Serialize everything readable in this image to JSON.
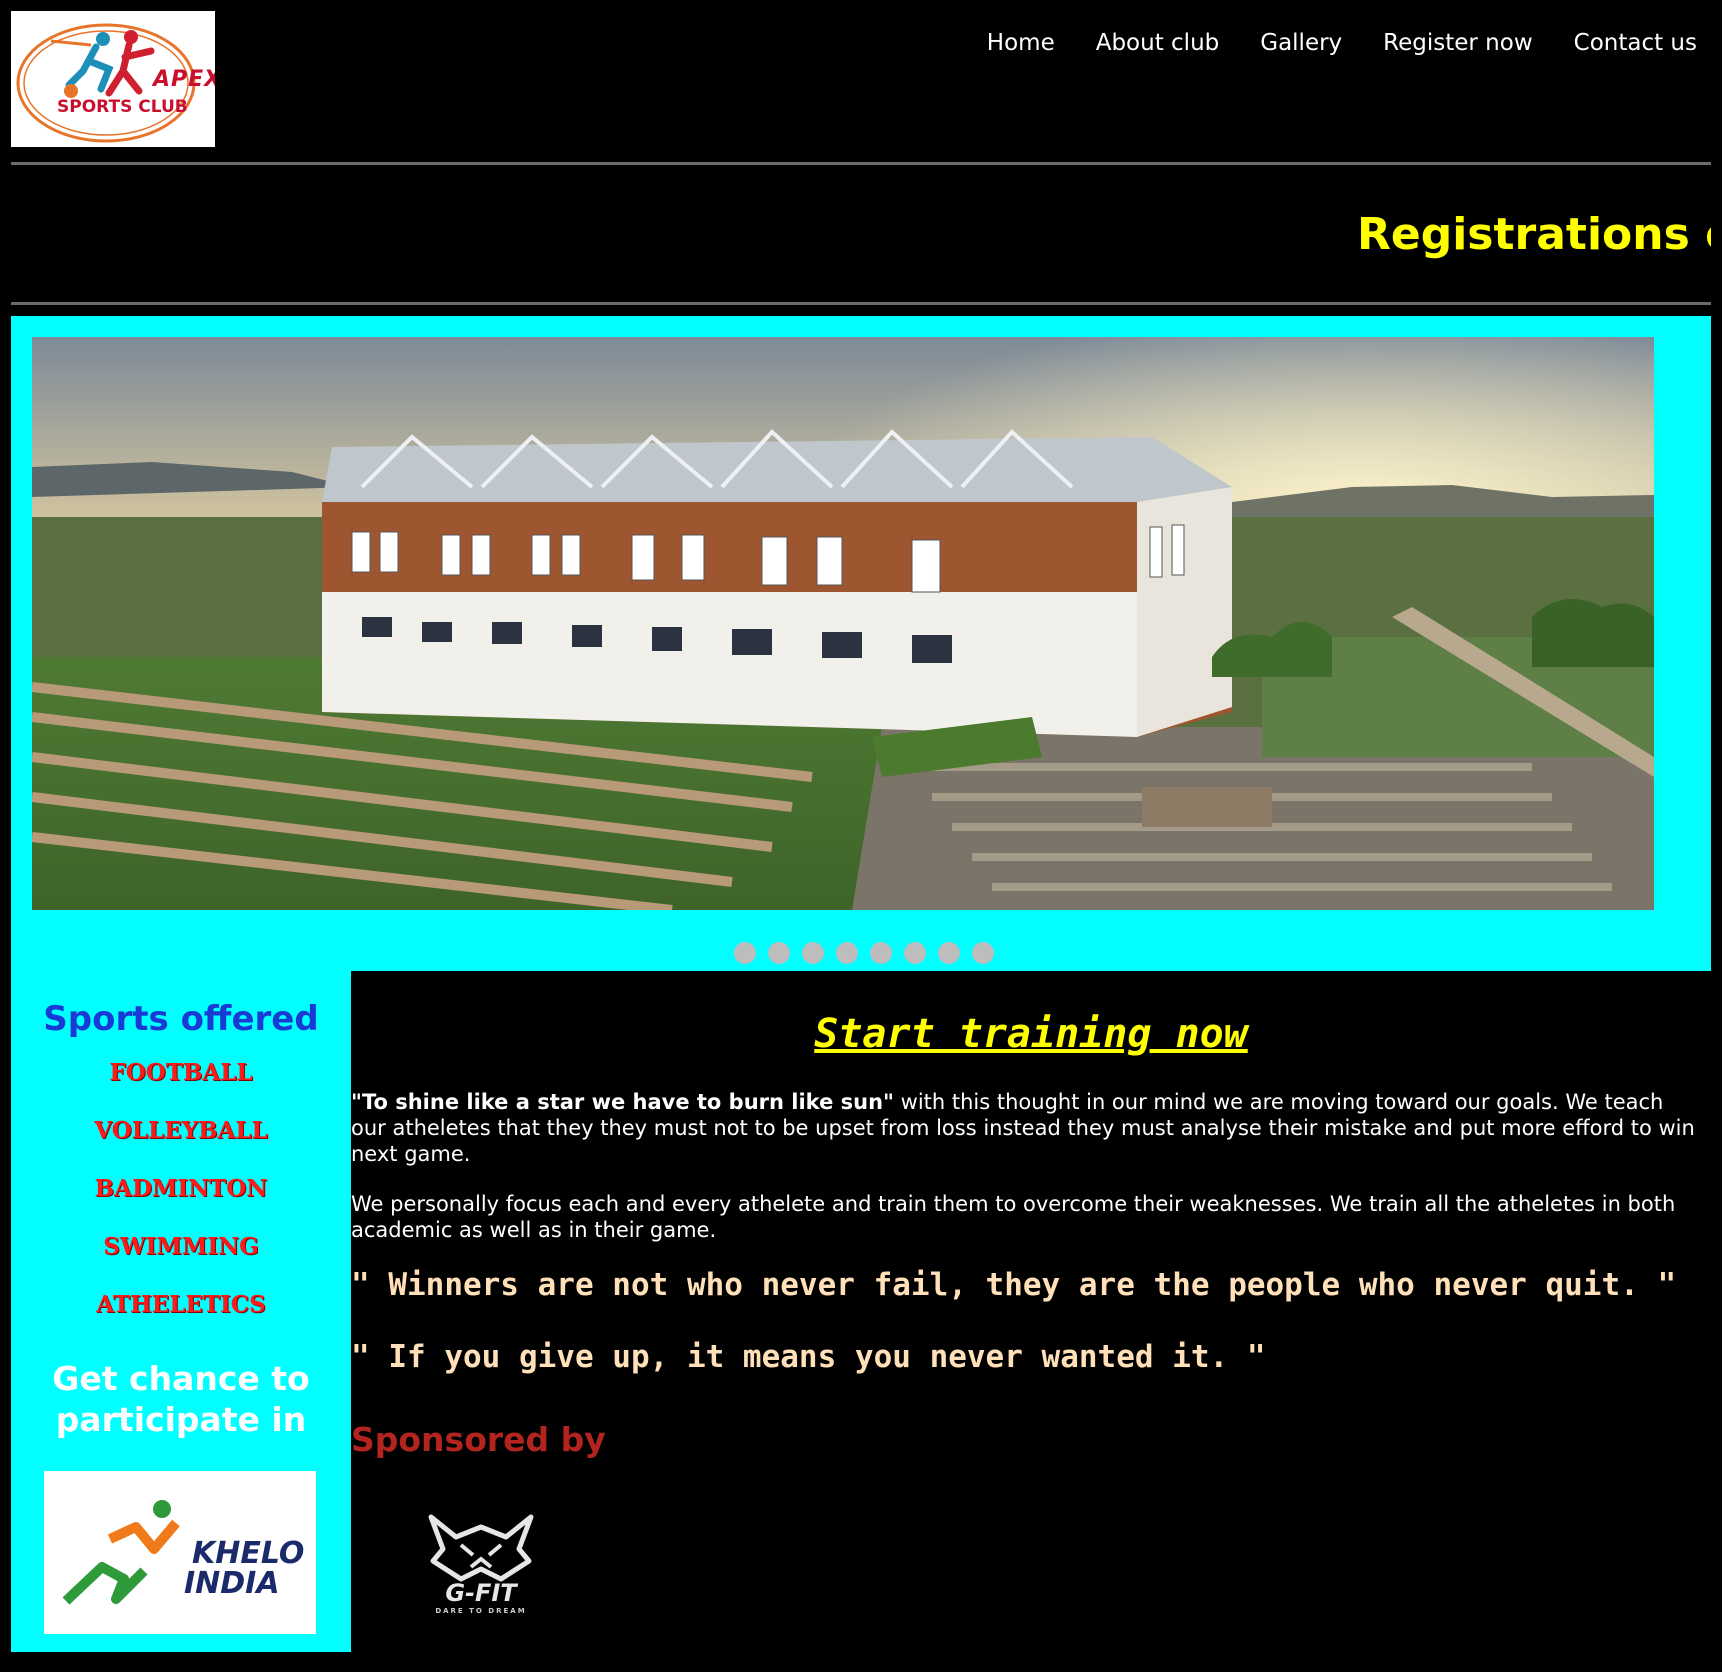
{
  "header": {
    "logo_line1": "APEX",
    "logo_line2": "SPORTS CLUB",
    "nav": [
      "Home",
      "About club",
      "Gallery",
      "Register now",
      "Contact us"
    ]
  },
  "marquee": {
    "text": "Registrations o"
  },
  "slider": {
    "dot_count": 8
  },
  "sidebar": {
    "title": "Sports offered",
    "sports": [
      "FOOTBALL",
      "VOLLEYBALL",
      "BADMINTON",
      "SWIMMING",
      "ATHELETICS"
    ],
    "chance_line1": "Get chance to",
    "chance_line2": "participate in",
    "khelo_line1": "KHELO",
    "khelo_line2": "INDIA"
  },
  "main": {
    "title": "Start training now",
    "para1_bold": "\"To shine like a star we have to burn like sun\"",
    "para1_rest": " with this thought in our mind we are moving toward our goals. We teach our atheletes that they they must not to be upset from loss instead they must analyse their mistake and put more efford to win next game.",
    "para2": "We personally focus each and every athelete and train them to overcome their weaknesses. We train all the atheletes in both academic as well as in their game.",
    "quote1": "\" Winners are not who never fail, they are the people who never quit. \"",
    "quote2": "\" If you give up, it means you never wanted it. \"",
    "sponsored_label": "Sponsored by",
    "sponsor_name": "G-FIT",
    "sponsor_tagline": "DARE TO DREAM"
  },
  "colors": {
    "accent_cyan": "#00ffff",
    "marquee_yellow": "#ffff00",
    "sports_red": "#ff1a1a",
    "sports_title_blue": "#1a3ad6",
    "sponsored_red": "#b3241f"
  }
}
